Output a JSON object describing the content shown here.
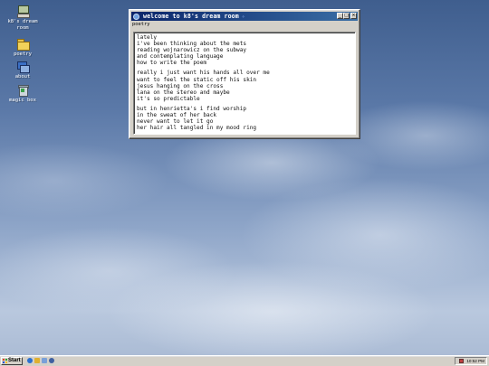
{
  "desktop": {
    "icons": [
      {
        "label": "k8's dream room",
        "icon": "computer-icon"
      },
      {
        "label": "poetry",
        "icon": "folder-icon"
      },
      {
        "label": "about",
        "icon": "windows-icon"
      },
      {
        "label": "magic box",
        "icon": "recycle-bin-icon"
      }
    ]
  },
  "window": {
    "title": "welcome to k8's dream room",
    "title_sparkle": "✧",
    "menu_label": "poetry",
    "controls": {
      "minimize": "_",
      "maximize": "□",
      "close": "×"
    },
    "poem": {
      "stanza1": [
        "lately",
        "i've been thinking about the mets",
        "reading wojnarowicz on the subway",
        "and contemplating language",
        "how to write the poem"
      ],
      "stanza2": [
        "really i just want his hands all over me",
        "want to feel the static off his skin",
        "jesus hanging on the cross",
        "lana on the stereo and maybe",
        "it's so predictable"
      ],
      "stanza3": [
        "but in henrietta's i find worship",
        "in the sweat of her back",
        "never want to let it go",
        "her hair all tangled in my mood ring"
      ]
    }
  },
  "taskbar": {
    "start_label": "Start",
    "quick_launch": [
      "ie-icon",
      "outlook-icon",
      "desktop-icon",
      "media-icon"
    ],
    "clock": "10:52 PM"
  },
  "colors": {
    "titlebar_start": "#0a246a",
    "titlebar_end": "#3a6ea5",
    "chrome": "#d4d0c8"
  }
}
